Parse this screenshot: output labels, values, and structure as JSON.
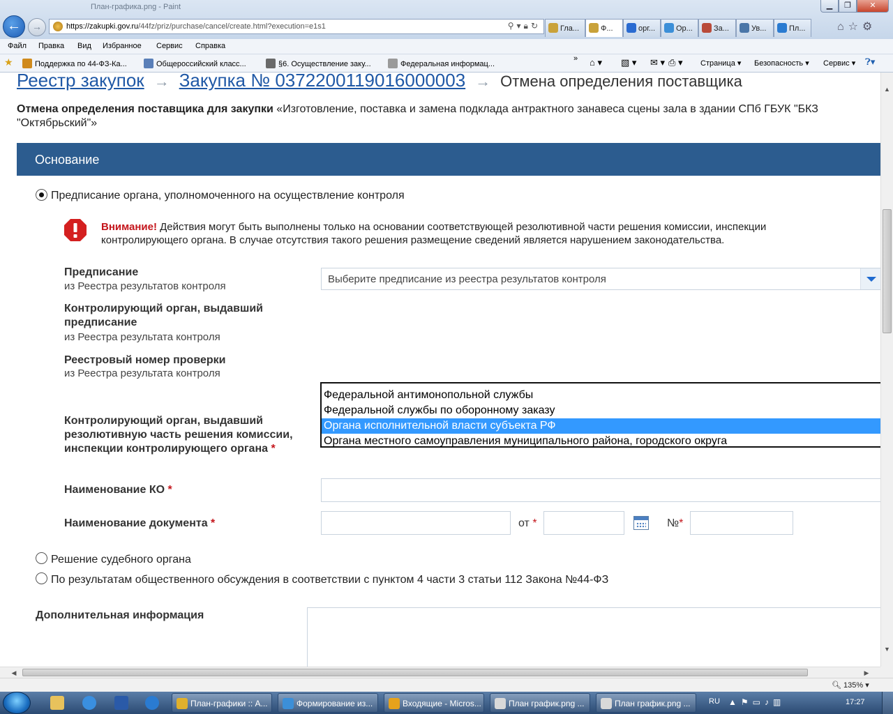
{
  "browser": {
    "window_title": "План-графика.png - Paint",
    "url_host": "https://zakupki.gov.ru",
    "url_path": "/44fz/priz/purchase/cancel/create.html?execution=e1s1",
    "tabs": [
      {
        "label": "Гла...",
        "icon": "gov-emblem-icon",
        "color": "#c9a23a",
        "active": false
      },
      {
        "label": "Ф...",
        "icon": "gov-emblem-icon",
        "color": "#c9a23a",
        "active": true
      },
      {
        "label": "орг...",
        "icon": "search-icon",
        "color": "#2a6bd1",
        "active": false
      },
      {
        "label": "Ор...",
        "icon": "ie-icon",
        "color": "#3c8fd8",
        "active": false
      },
      {
        "label": "За...",
        "icon": "tools-icon",
        "color": "#b94b3a",
        "active": false
      },
      {
        "label": "Ув...",
        "icon": "vk-icon",
        "color": "#4a76a8",
        "active": false
      },
      {
        "label": "Пл...",
        "icon": "help-icon",
        "color": "#2a7bd1",
        "active": false
      }
    ],
    "menu": [
      "Файл",
      "Правка",
      "Вид",
      "Избранное",
      "Сервис",
      "Справка"
    ],
    "favorites": [
      {
        "label": "Поддержка по 44-ФЗ-Ка...",
        "color": "#d08a1c"
      },
      {
        "label": "Общероссийский класс...",
        "color": "#5a7fb8"
      },
      {
        "label": "§6. Осуществление заку...",
        "color": "#6a6a6a"
      },
      {
        "label": "Федеральная информац...",
        "color": "#9a9a9a"
      }
    ],
    "commands": [
      "Страница",
      "Безопасность",
      "Сервис"
    ]
  },
  "breadcrumb": {
    "registry": "Реестр закупок",
    "purchase": "Закупка № 0372200119016000003",
    "current": "Отмена определения поставщика"
  },
  "heading": {
    "bold": "Отмена определения поставщика для закупки",
    "text": " «Изготовление, поставка и замена подклада антрактного занавеса сцены зала в здании СПб ГБУК \"БКЗ \"Октябрьский\"»"
  },
  "section": {
    "title": "Основание",
    "radio_prescription": "Предписание органа, уполномоченного на осуществление контроля",
    "warning_title": "Внимание!",
    "warning_text": " Действия могут быть выполнены только на основании соответствующей резолютивной части решения комиссии, инспекции контролирующего органа. В случае отсутствия такого решения размещение сведений является нарушением законодательства.",
    "fields": {
      "prescription_label": "Предписание",
      "prescription_sub": "из Реестра результатов контроля",
      "prescription_placeholder": "Выберите предписание из реестра результатов контроля",
      "issuer_label": "Контролирующий орган, выдавший предписание",
      "issuer_sub": "из Реестра результата контроля",
      "check_number_label": "Реестровый номер проверки",
      "check_number_sub": "из Реестра результата контроля",
      "resolution_organ_label": "Контролирующий орган, выдавший резолютивную часть решения комиссии, инспекции контролирующего органа",
      "ko_name_label": "Наименование КО",
      "doc_name_label": "Наименование документа",
      "from_label": "от",
      "number_label": "№",
      "required_mark": "*"
    },
    "dropdown_options": [
      {
        "label": "Федеральной антимонопольной службы",
        "selected": false
      },
      {
        "label": "Федеральной службы по оборонному заказу",
        "selected": false
      },
      {
        "label": "Органа исполнительной власти субъекта РФ",
        "selected": true
      },
      {
        "label": "Органа местного самоуправления муниципального района, городского округа",
        "selected": false
      }
    ],
    "radio_court": "Решение судебного органа",
    "radio_public": "По результатам общественного обсуждения в соответствии с пунктом 4 части 3 статьи 112 Закона №44-ФЗ",
    "extra_info_label": "Дополнительная информация"
  },
  "status": {
    "zoom": "135%"
  },
  "taskbar": {
    "buttons": [
      {
        "label": "План-графики :: А...",
        "icon": "chrome-icon",
        "color": "#e0b02c"
      },
      {
        "label": "Формирование из...",
        "icon": "ie-icon",
        "color": "#3c8fd8"
      },
      {
        "label": "Входящие - Micros...",
        "icon": "outlook-icon",
        "color": "#e6a21c"
      },
      {
        "label": "План график.png ...",
        "icon": "paint-icon",
        "color": "#d9d9d9"
      },
      {
        "label": "План график.png ...",
        "icon": "paint-icon",
        "color": "#d9d9d9"
      }
    ],
    "lang": "RU",
    "time": "17:27"
  }
}
